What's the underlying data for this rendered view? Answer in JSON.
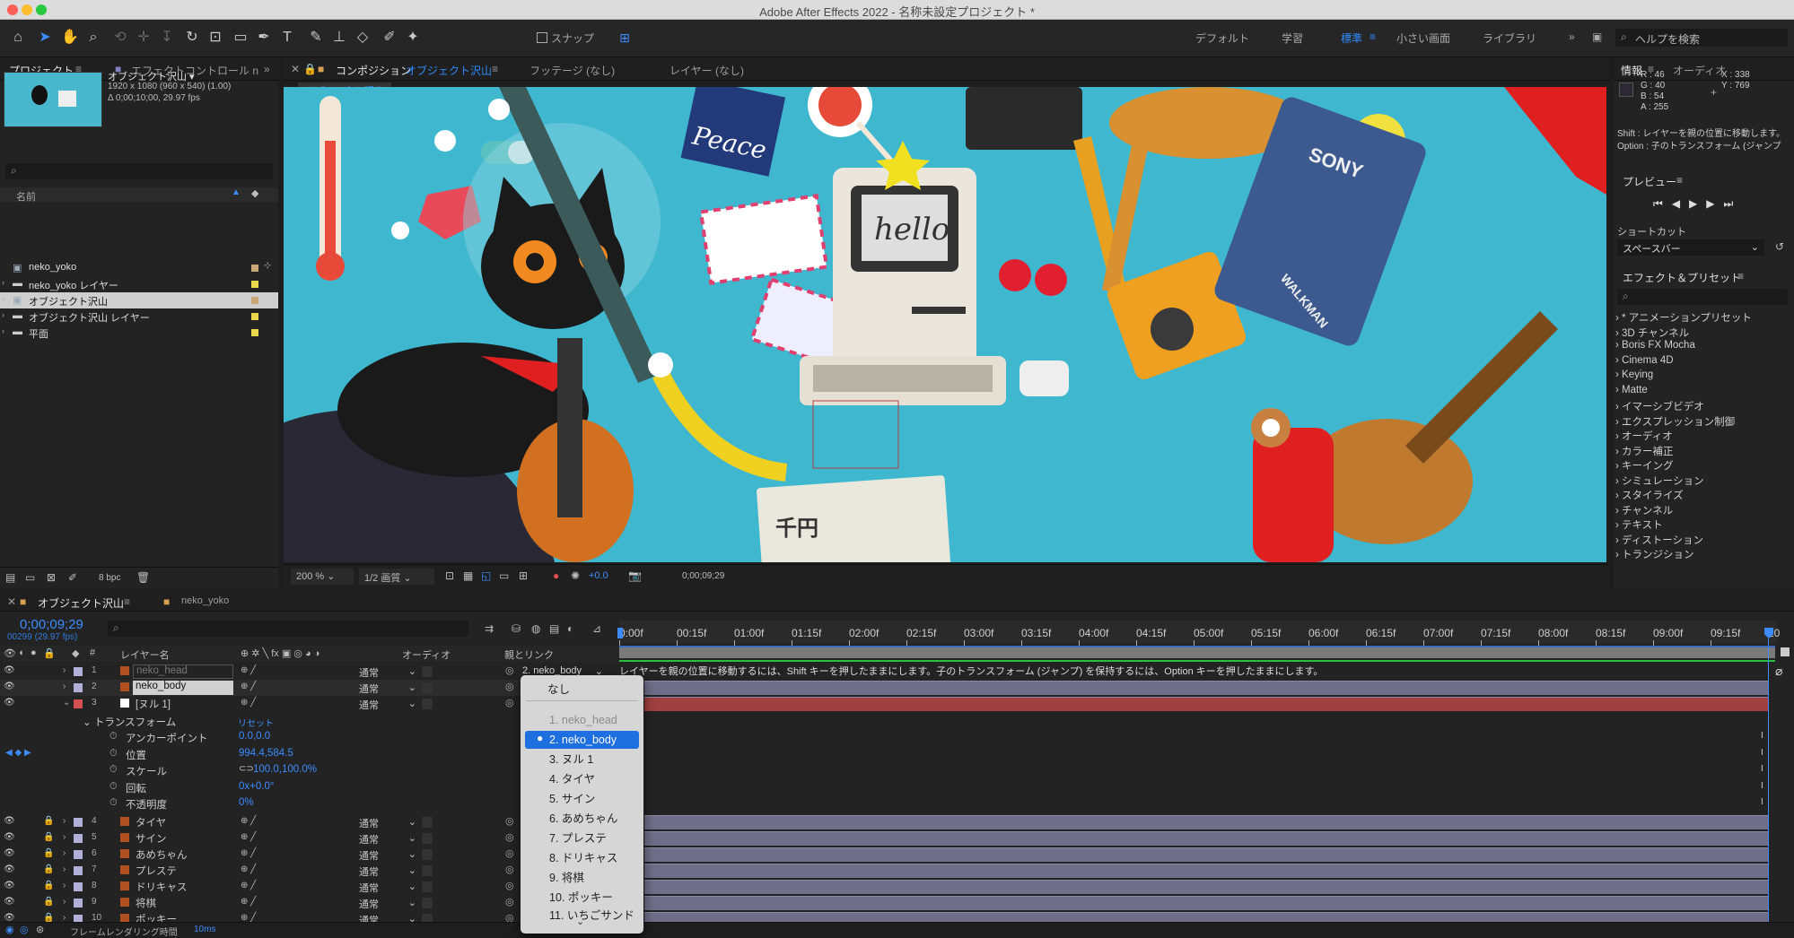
{
  "window": {
    "title": "Adobe After Effects 2022 - 名称未設定プロジェクト *"
  },
  "toolbar": {
    "snap_label": "スナップ",
    "workspaces": [
      "デフォルト",
      "学習",
      "標準",
      "小さい画面",
      "ライブラリ"
    ],
    "search_placeholder": "ヘルプを検索"
  },
  "project_panel": {
    "tab_project": "プロジェクト",
    "tab_effects": "エフェクトコントロール n",
    "comp_name": "オブジェクト沢山 ▾",
    "comp_dims": "1920 x 1080  (960 x 540) (1.00)",
    "comp_duration": "Δ 0;00;10;00, 29.97 fps",
    "column_name": "名前",
    "items": [
      {
        "name": "neko_yoko",
        "color": "#c8a878"
      },
      {
        "name": "neko_yoko レイヤー",
        "color": "#e8d84a"
      },
      {
        "name": "オブジェクト沢山",
        "color": "#c8a878"
      },
      {
        "name": "オブジェクト沢山 レイヤー",
        "color": "#e8d84a"
      },
      {
        "name": "平面",
        "color": "#e8d84a"
      }
    ],
    "bpc": "8 bpc"
  },
  "comp_panel": {
    "tab_label": "コンポジション",
    "tab_comp": "オブジェクト沢山",
    "tab_footage": "フッテージ (なし)",
    "tab_layer": "レイヤー (なし)",
    "breadcrumb": "オブジェクト沢山",
    "zoom": "200 %",
    "resolution": "1/2 画質",
    "exposure": "+0.0",
    "timecode": "0;00;09;29",
    "canvas_text": {
      "hello": "hello",
      "sony": "SONY",
      "walkman": "WALKMAN",
      "peace": "Peace",
      "yen": "千円"
    }
  },
  "info_panel": {
    "tab_info": "情報",
    "tab_audio": "オーディオ",
    "r": "R : 46",
    "g": "G : 40",
    "b": "B : 54",
    "a": "A : 255",
    "x": "X : 338",
    "y": "Y : 769",
    "hint1": "Shift : レイヤーを親の位置に移動します。",
    "hint2": "Option : 子のトランスフォーム (ジャンプ",
    "preview_title": "プレビュー",
    "shortcut_title": "ショートカット",
    "shortcut_value": "スペースバー",
    "effects_title": "エフェクト＆プリセット",
    "effects": [
      "* アニメーションプリセット",
      "3D チャンネル",
      "Boris FX Mocha",
      "Cinema 4D",
      "Keying",
      "Matte",
      "イマーシブビデオ",
      "エクスプレッション制御",
      "オーディオ",
      "カラー補正",
      "キーイング",
      "シミュレーション",
      "スタイライズ",
      "チャンネル",
      "テキスト",
      "ディストーション",
      "トランジション"
    ]
  },
  "timeline": {
    "tab_comp": "オブジェクト沢山",
    "tab_neko": "neko_yoko",
    "current_time": "0;00;09;29",
    "frame_info": "00299 (29.97 fps)",
    "col_layer_name": "レイヤー名",
    "col_audio": "オーディオ",
    "col_parent": "親とリンク",
    "ruler": [
      "0:00f",
      "00:15f",
      "01:00f",
      "01:15f",
      "02:00f",
      "02:15f",
      "03:00f",
      "03:15f",
      "04:00f",
      "04:15f",
      "05:00f",
      "05:15f",
      "06:00f",
      "06:15f",
      "07:00f",
      "07:15f",
      "08:00f",
      "08:15f",
      "09:00f",
      "09:15f",
      "10"
    ],
    "hint_bar": "レイヤーを親の位置に移動するには、Shift キーを押したままにします。子のトランスフォーム (ジャンプ) を保持するには、Option キーを押したままにします。",
    "layers": [
      {
        "num": "1",
        "name": "neko_head",
        "mode": "通常",
        "parent": "2. neko_body",
        "color": "#b0b0d8"
      },
      {
        "num": "2",
        "name": "neko_body",
        "mode": "通常",
        "parent": "なし",
        "color": "#b0b0d8"
      },
      {
        "num": "3",
        "name": "[ヌル 1]",
        "mode": "通常",
        "parent": "なし",
        "color": "#d45050"
      },
      {
        "num": "4",
        "name": "タイヤ",
        "mode": "通常",
        "parent": "なし",
        "color": "#b0b0d8"
      },
      {
        "num": "5",
        "name": "サイン",
        "mode": "通常",
        "parent": "なし",
        "color": "#b0b0d8"
      },
      {
        "num": "6",
        "name": "あめちゃん",
        "mode": "通常",
        "parent": "なし",
        "color": "#b0b0d8"
      },
      {
        "num": "7",
        "name": "プレステ",
        "mode": "通常",
        "parent": "なし",
        "color": "#b0b0d8"
      },
      {
        "num": "8",
        "name": "ドリキャス",
        "mode": "通常",
        "parent": "なし",
        "color": "#b0b0d8"
      },
      {
        "num": "9",
        "name": "将棋",
        "mode": "通常",
        "parent": "なし",
        "color": "#b0b0d8"
      },
      {
        "num": "10",
        "name": "ポッキー",
        "mode": "通常",
        "parent": "なし",
        "color": "#b0b0d8"
      }
    ],
    "transform": {
      "title": "トランスフォーム",
      "reset": "リセット",
      "props": [
        {
          "name": "アンカーポイント",
          "value": "0.0,0.0"
        },
        {
          "name": "位置",
          "value": "994.4,584.5"
        },
        {
          "name": "スケール",
          "value": "100.0,100.0%"
        },
        {
          "name": "回転",
          "value": "0x+0.0°"
        },
        {
          "name": "不透明度",
          "value": "0%"
        }
      ]
    },
    "footer": "フレームレンダリング時間",
    "footer_value": "10ms"
  },
  "parent_dropdown": {
    "items": [
      "なし",
      "1. neko_head",
      "2. neko_body",
      "3. ヌル 1",
      "4. タイヤ",
      "5. サイン",
      "6. あめちゃん",
      "7. プレステ",
      "8. ドリキャス",
      "9. 将棋",
      "10. ポッキー",
      "11. いちごサンド"
    ],
    "selected_index": 2,
    "disabled_index": 1
  }
}
